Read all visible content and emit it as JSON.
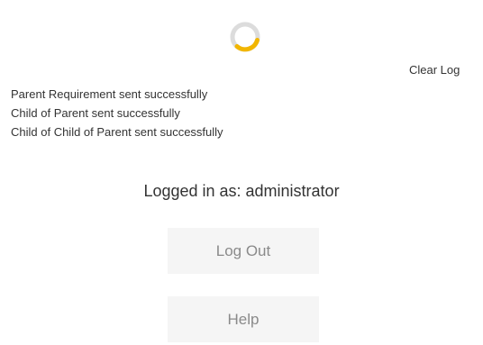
{
  "colors": {
    "spinner_track": "#dcdcdc",
    "spinner_accent": "#f2b600",
    "button_background": "#f5f5f5",
    "button_text": "#8a8a8a",
    "text": "#333333"
  },
  "spinner": {
    "icon": "loading-spinner-icon"
  },
  "toolbar": {
    "clear_log_label": "Clear Log"
  },
  "log": {
    "entries": [
      "Parent Requirement sent successfully",
      "Child of Parent sent successfully",
      "Child of Child of Parent sent successfully"
    ]
  },
  "session": {
    "logged_in_text": "Logged in as: administrator"
  },
  "buttons": {
    "logout_label": "Log Out",
    "help_label": "Help"
  }
}
